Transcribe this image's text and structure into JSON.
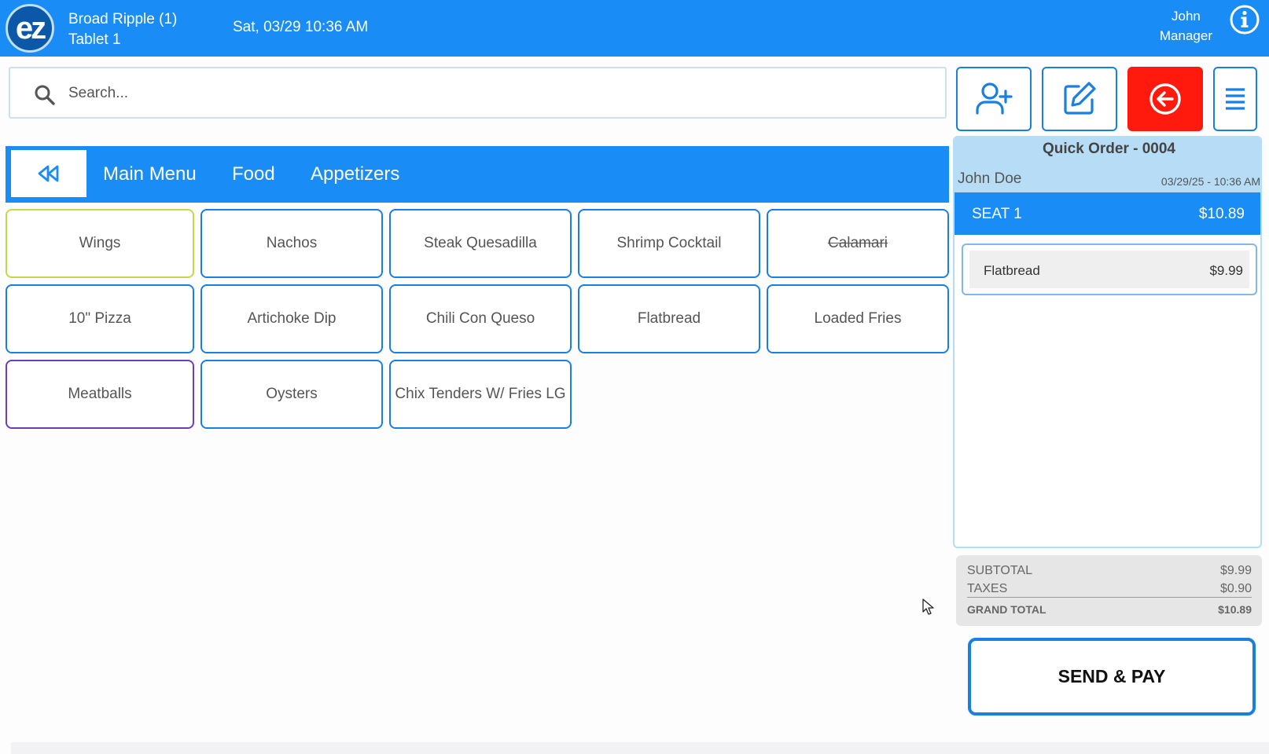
{
  "header": {
    "logo_text": "ez",
    "store_name": "Broad Ripple (1)",
    "device_name": "Tablet 1",
    "datetime": "Sat, 03/29 10:36 AM",
    "user_name": "John",
    "user_role": "Manager",
    "info_icon": "info-icon",
    "color": "#1a8cf5"
  },
  "search": {
    "placeholder": "Search...",
    "value": ""
  },
  "actions": {
    "add_customer_icon": "add-user-icon",
    "edit_icon": "edit-icon",
    "back_icon": "arrow-left-circle-icon",
    "menu_icon": "hamburger-menu-icon",
    "back_color": "#ff1a0d"
  },
  "breadcrumb": {
    "back_icon": "rewind-icon",
    "items": [
      "Main Menu",
      "Food",
      "Appetizers"
    ]
  },
  "menu_items": [
    {
      "label": "Wings",
      "border": "#c5d84a"
    },
    {
      "label": "Nachos",
      "border": "#1a7fe0"
    },
    {
      "label": "Steak Quesadilla",
      "border": "#1a7fe0"
    },
    {
      "label": "Shrimp Cocktail",
      "border": "#1a7fe0"
    },
    {
      "label": "Calamari",
      "border": "#1a7fe0",
      "unavailable": true
    },
    {
      "label": "10\" Pizza",
      "border": "#1a7fe0"
    },
    {
      "label": "Artichoke Dip",
      "border": "#1a7fe0"
    },
    {
      "label": "Chili Con Queso",
      "border": "#1a7fe0"
    },
    {
      "label": "Flatbread",
      "border": "#1a7fe0"
    },
    {
      "label": "Loaded Fries",
      "border": "#1a7fe0"
    },
    {
      "label": "Meatballs",
      "border": "#6a3fb8"
    },
    {
      "label": "Oysters",
      "border": "#1a7fe0"
    },
    {
      "label": "Chix Tenders W/ Fries LG",
      "border": "#1a7fe0"
    }
  ],
  "order": {
    "title": "Quick Order - 0004",
    "customer": "John Doe",
    "timestamp": "03/29/25  - 10:36 AM",
    "seat": {
      "label": "SEAT 1",
      "total": "$10.89"
    },
    "lines": [
      {
        "name": "Flatbread",
        "price": "$9.99"
      }
    ]
  },
  "totals": {
    "subtotal_label": "SUBTOTAL",
    "subtotal": "$9.99",
    "taxes_label": "TAXES",
    "taxes": "$0.90",
    "grand_label": "GRAND TOTAL",
    "grand": "$10.89"
  },
  "send_pay_label": "SEND & PAY"
}
